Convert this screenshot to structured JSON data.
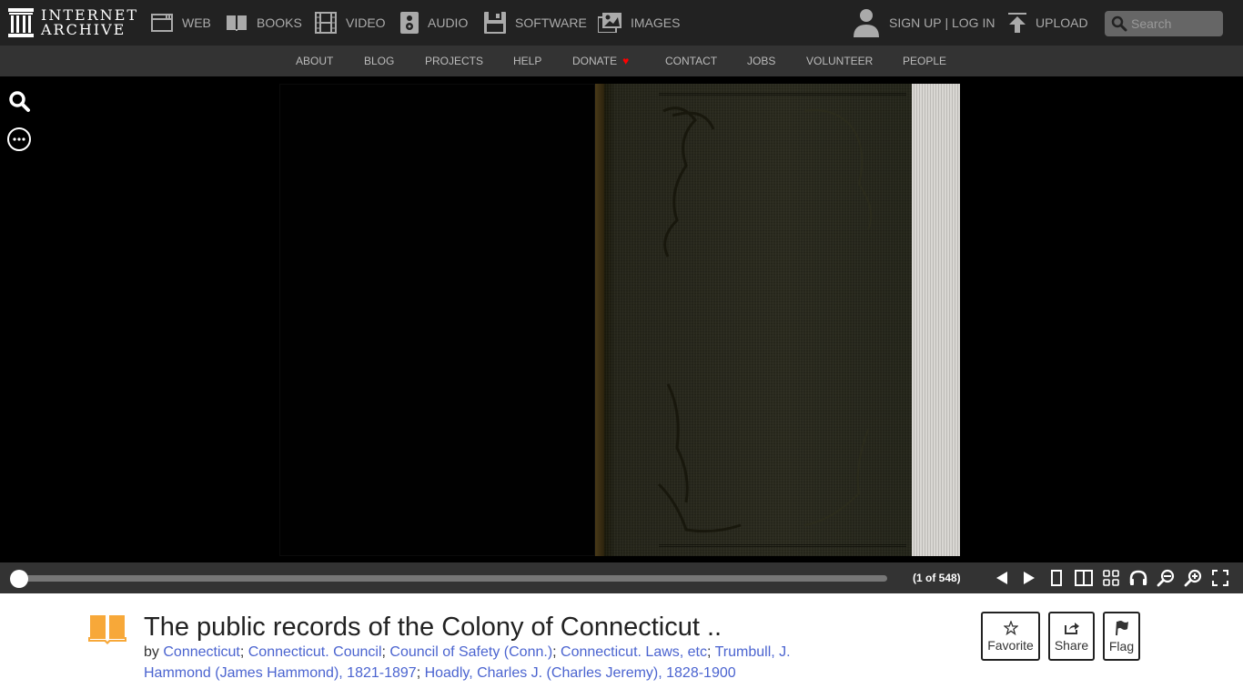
{
  "topnav": {
    "logo_line1": "INTERNET",
    "logo_line2": "ARCHIVE",
    "media": [
      {
        "label": "WEB",
        "icon": "web-icon"
      },
      {
        "label": "BOOKS",
        "icon": "books-icon"
      },
      {
        "label": "VIDEO",
        "icon": "video-icon"
      },
      {
        "label": "AUDIO",
        "icon": "audio-icon"
      },
      {
        "label": "SOFTWARE",
        "icon": "software-icon"
      },
      {
        "label": "IMAGES",
        "icon": "images-icon"
      }
    ],
    "sign_up": "SIGN UP",
    "separator": " | ",
    "log_in": "LOG IN",
    "upload": "UPLOAD",
    "search_placeholder": "Search"
  },
  "subnav": {
    "items": [
      "ABOUT",
      "BLOG",
      "PROJECTS",
      "HELP",
      "DONATE",
      "CONTACT",
      "JOBS",
      "VOLUNTEER",
      "PEOPLE"
    ],
    "donate_heart": "♥"
  },
  "viewer": {
    "current_page": 1,
    "total_pages": 548,
    "page_count_text": "(1 of 548)",
    "progress_fraction": 0.0
  },
  "item": {
    "title": "The public records of the Colony of Connecticut ..",
    "by_label": "by",
    "creators": [
      "Connecticut",
      "Connecticut. Council",
      "Council of Safety (Conn.)",
      "Connecticut. Laws, etc",
      "Trumbull, J. Hammond (James Hammond), 1821-1897",
      "Hoadly, Charles J. (Charles Jeremy), 1828-1900"
    ],
    "actions": {
      "favorite": "Favorite",
      "share": "Share",
      "flag": "Flag"
    }
  },
  "colors": {
    "topnav_bg": "#222222",
    "subnav_bg": "#333333",
    "link": "#4b64d0",
    "book_icon": "#f7a839",
    "heart": "#ff0000"
  }
}
